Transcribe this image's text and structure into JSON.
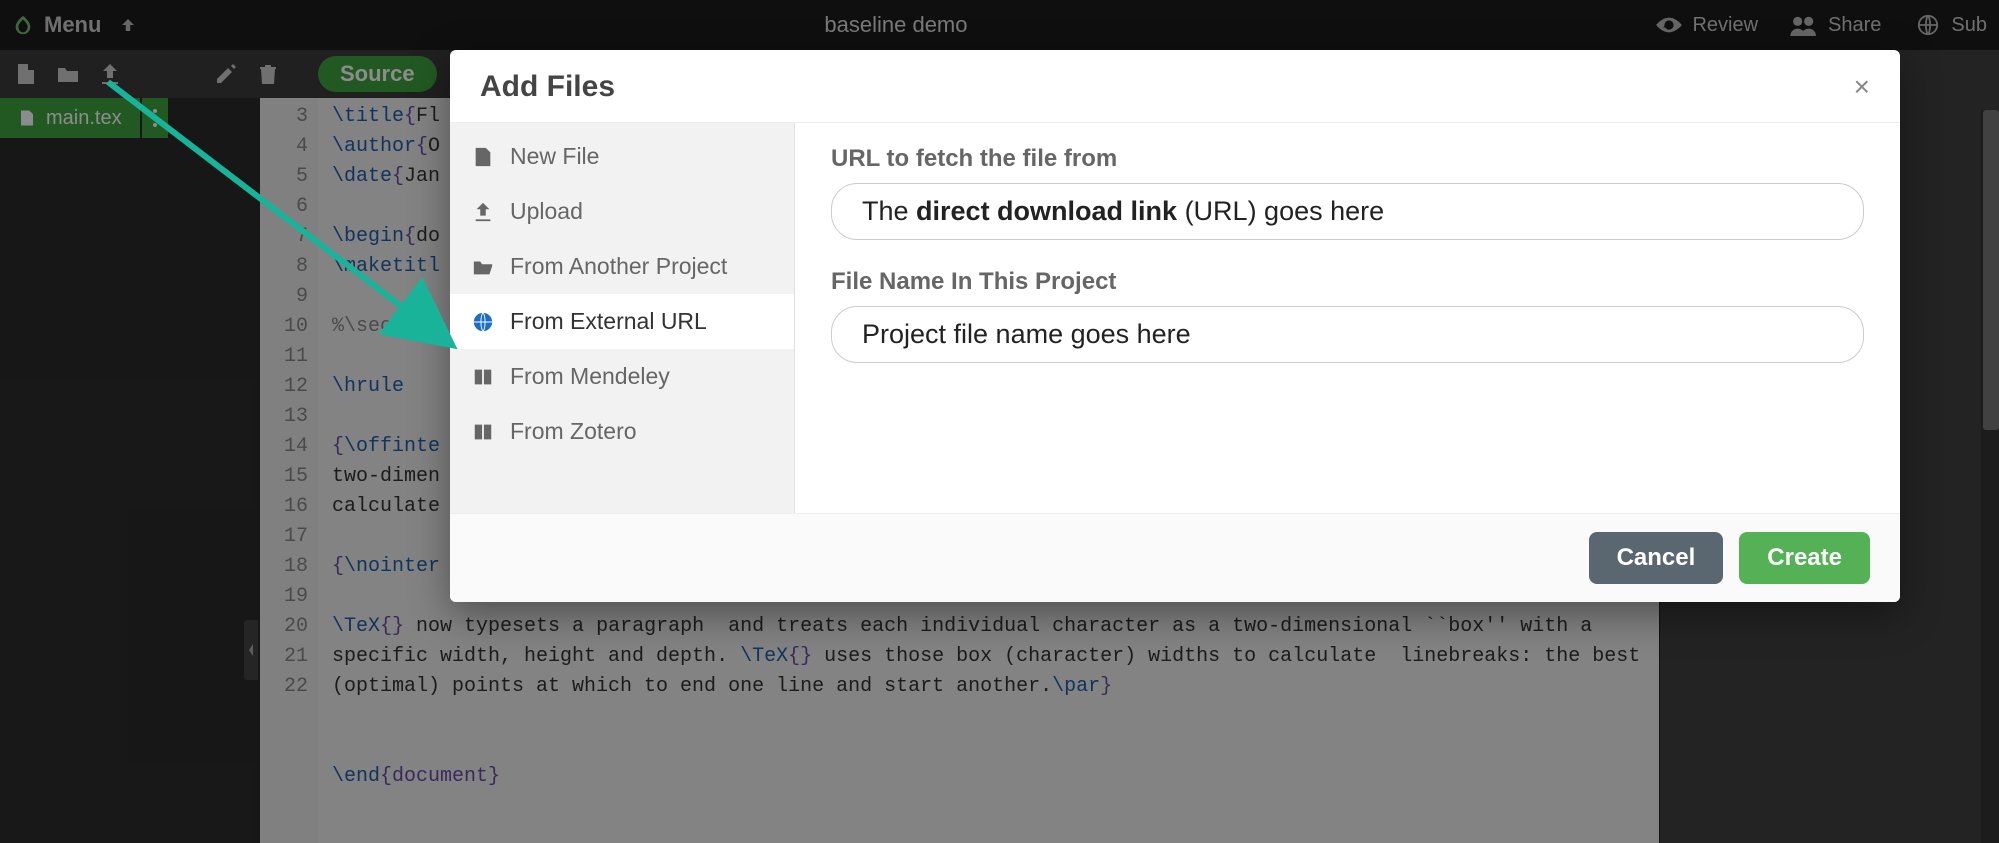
{
  "topbar": {
    "menu_label": "Menu",
    "title": "baseline demo",
    "review_label": "Review",
    "share_label": "Share",
    "submit_label": "Sub"
  },
  "toolbar": {
    "source_label": "Source"
  },
  "filetab": {
    "name": "main.tex"
  },
  "editor": {
    "gutter": [
      "3",
      "4",
      "5",
      "6",
      "7",
      "8",
      "9",
      "10",
      "11",
      "12",
      "13",
      "14",
      "",
      "",
      "15",
      "16",
      "17",
      "18",
      "",
      "",
      "19",
      "20",
      "21",
      "22"
    ],
    "lines_html": [
      "<span class='tok-cmd'>\\title</span><span class='tok-brace'>{</span>Fl",
      "<span class='tok-cmd'>\\author</span><span class='tok-brace'>{</span>O",
      "<span class='tok-cmd'>\\date</span><span class='tok-brace'>{</span>Jan",
      "",
      "<span class='tok-cmd'>\\begin</span><span class='tok-brace'>{</span>do",
      "<span class='tok-cmd'>\\maketitl</span>",
      "",
      "<span class='tok-comment'>%\\section</span>",
      "",
      "<span class='tok-cmd'>\\hrule</span>",
      "",
      "<span class='tok-brace'>{</span><span class='tok-cmd'>\\offinte</span>",
      "two-dimen",
      "calculate",
      "",
      "<span class='tok-brace'>{</span><span class='tok-cmd'>\\nointer</span>",
      "",
      "<span class='tok-cmd'>\\TeX</span><span class='tok-brace'>{}</span> now typesets a paragraph  and treats each individual character as a two-dimensional ``box'' with a",
      "specific width, height and depth. <span class='tok-cmd'>\\TeX</span><span class='tok-brace'>{}</span> uses those box (character) widths to calculate  linebreaks: the best",
      "(optimal) points at which to end one line and start another.<span class='tok-cmd'>\\par</span><span class='tok-brace'>}</span>",
      "",
      "",
      "<span class='tok-cmd'>\\end</span><span class='tok-brace'>{</span><span class='tok-brace'>document</span><span class='tok-brace'>}</span>",
      ""
    ]
  },
  "modal": {
    "title": "Add Files",
    "sidebar": {
      "new_file": "New File",
      "upload": "Upload",
      "from_project": "From Another Project",
      "from_url": "From External URL",
      "from_mendeley": "From Mendeley",
      "from_zotero": "From Zotero"
    },
    "url_label": "URL to fetch the file from",
    "url_placeholder_pre": "The ",
    "url_placeholder_bold": "direct download link",
    "url_placeholder_post": " (URL) goes here",
    "filename_label": "File Name In This Project",
    "filename_placeholder": "Project file name goes here",
    "cancel": "Cancel",
    "create": "Create"
  }
}
